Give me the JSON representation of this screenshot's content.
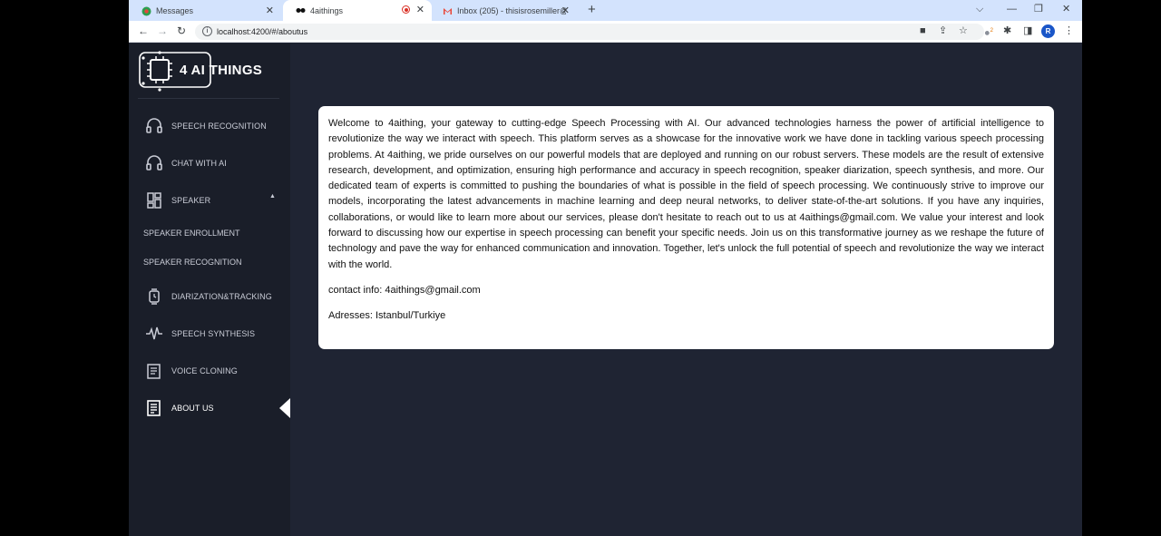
{
  "browser": {
    "tabs": [
      {
        "label": "Messages",
        "favicon": "messages-icon"
      },
      {
        "label": "4aithings",
        "favicon": "aithings-icon",
        "recording": true
      },
      {
        "label": "Inbox (205) - thisisrosemiller@gr",
        "favicon": "gmail-icon"
      }
    ],
    "url": "localhost:4200/#/aboutus",
    "profile_initial": "R",
    "extension_badge": "2"
  },
  "logo": {
    "text": "4 AI THINGS"
  },
  "sidebar": {
    "items": [
      {
        "label": "SPEECH RECOGNITION",
        "icon": "headphones-icon"
      },
      {
        "label": "CHAT WITH AI",
        "icon": "headphones-icon"
      },
      {
        "label": "SPEAKER",
        "icon": "dashboard-icon",
        "expanded": true
      },
      {
        "label": "DIARIZATION&TRACKING",
        "icon": "watch-icon"
      },
      {
        "label": "SPEECH SYNTHESIS",
        "icon": "waveform-icon"
      },
      {
        "label": "VOICE CLONING",
        "icon": "document-icon"
      },
      {
        "label": "ABOUT US",
        "icon": "receipt-icon",
        "active": true
      }
    ],
    "speaker_sub": [
      "SPEAKER ENROLLMENT",
      "SPEAKER RECOGNITION"
    ]
  },
  "about": {
    "text": "Welcome to 4aithing, your gateway to cutting-edge Speech Processing with AI. Our advanced technologies harness the power of artificial intelligence to revolutionize the way we interact with speech. This platform serves as a showcase for the innovative work we have done in tackling various speech processing problems. At 4aithing, we pride ourselves on our powerful models that are deployed and running on our robust servers. These models are the result of extensive research, development, and optimization, ensuring high performance and accuracy in speech recognition, speaker diarization, speech synthesis, and more. Our dedicated team of experts is committed to pushing the boundaries of what is possible in the field of speech processing. We continuously strive to improve our models, incorporating the latest advancements in machine learning and deep neural networks, to deliver state-of-the-art solutions. If you have any inquiries, collaborations, or would like to learn more about our services, please don't hesitate to reach out to us at 4aithings@gmail.com. We value your interest and look forward to discussing how our expertise in speech processing can benefit your specific needs. Join us on this transformative journey as we reshape the future of technology and pave the way for enhanced communication and innovation. Together, let's unlock the full potential of speech and revolutionize the way we interact with the world.",
    "contact": "contact info: 4aithings@gmail.com",
    "address": "Adresses: Istanbul/Turkiye"
  },
  "colors": {
    "page_bg": "#1f2433",
    "sidebar_bg": "#1a1e29",
    "card_bg": "#ffffff",
    "tabstrip_bg": "#d3e3fd"
  }
}
